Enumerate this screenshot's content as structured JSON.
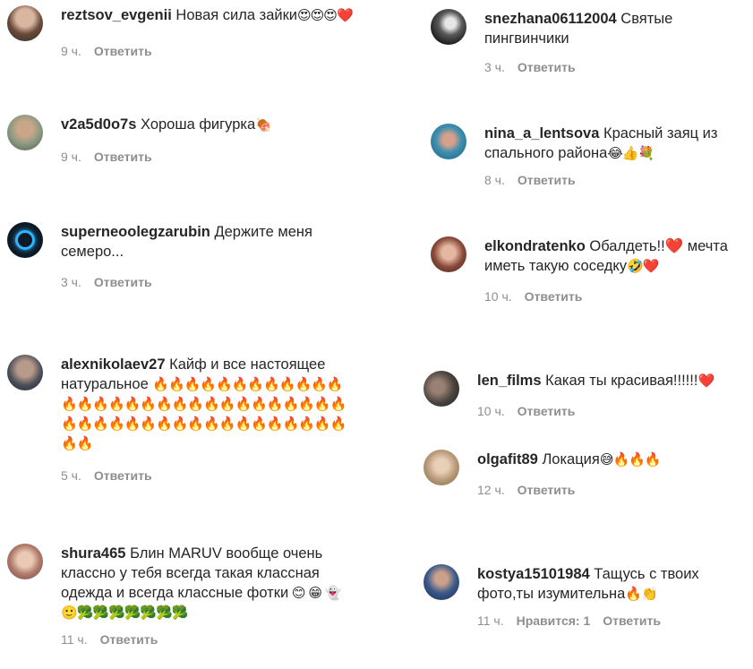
{
  "reply_label": "Ответить",
  "left": [
    {
      "user": "reztsov_evgenii",
      "text": "Новая сила зайки",
      "emoji": "😍😍😍❤️",
      "time": "9 ч."
    },
    {
      "user": "v2a5d0o7s",
      "text": "Хороша фигурка",
      "emoji": "🍖",
      "time": "9 ч."
    },
    {
      "user": "superneoolegzarubin",
      "text": "Держите меня семеро...",
      "emoji": "",
      "time": "3 ч."
    },
    {
      "user": "alexnikolaev27",
      "text": "Кайф и все настоящее натуральное",
      "emoji": "🔥🔥🔥🔥🔥🔥🔥🔥🔥🔥🔥🔥🔥🔥🔥🔥🔥🔥🔥🔥🔥🔥🔥🔥🔥🔥🔥🔥🔥🔥🔥🔥🔥🔥🔥🔥🔥🔥🔥🔥🔥🔥🔥🔥🔥🔥🔥🔥🔥🔥",
      "time": "5 ч."
    },
    {
      "user": "shura465",
      "text": "Блин MARUV вообще очень классно у тебя всегда такая классная одежда и всегда классные фотки",
      "emoji": " 😊 😁 👻 🙂🥦🥦🥦🥦🥦🥦🥦",
      "time": "11 ч."
    }
  ],
  "right": [
    {
      "user": "snezhana06112004",
      "text": "Святые пингвинчики",
      "emoji": "",
      "time": "3 ч."
    },
    {
      "user": "nina_a_lentsova",
      "text": "Красный заяц из спального района",
      "emoji": "😂👍💐",
      "time": "8 ч."
    },
    {
      "user": "elkondratenko",
      "text": "Обалдеть!!❤️ мечта иметь такую соседку",
      "emoji": "🤣❤️",
      "time": "10 ч."
    },
    {
      "user": "len_films",
      "text": "Какая ты красивая!!!!!!",
      "emoji": "❤️",
      "time": "10 ч."
    },
    {
      "user": "olgafit89",
      "text": "Локация",
      "emoji": "😅🔥🔥🔥",
      "time": "12 ч."
    },
    {
      "user": "kostya15101984",
      "text": "Тащусь с твоих фото,ты изумительна",
      "emoji": "🔥👏",
      "time": "11 ч.",
      "likes": "Нравится: 1"
    }
  ]
}
